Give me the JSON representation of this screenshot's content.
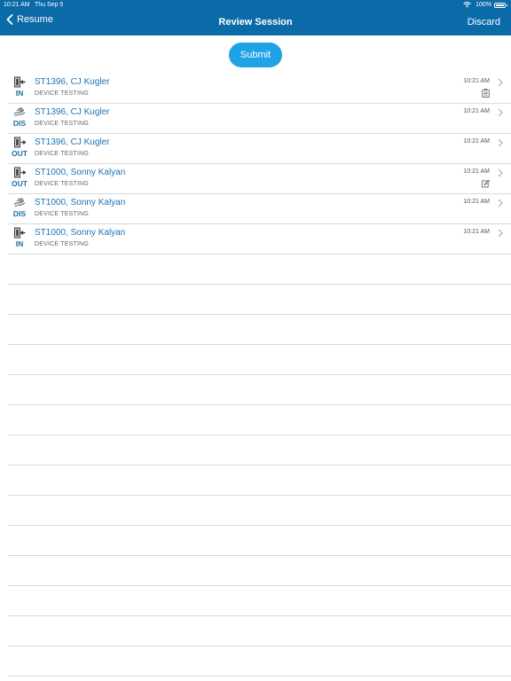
{
  "status_bar": {
    "time": "10:21 AM",
    "date": "Thu Sep 5",
    "battery": "100%"
  },
  "nav": {
    "back_label": "Resume",
    "title": "Review Session",
    "discard_label": "Discard"
  },
  "submit_label": "Submit",
  "colors": {
    "nav_background": "#0b6aa8",
    "submit_background": "#1ea3e6",
    "link_text": "#1a73b5"
  },
  "rows": [
    {
      "type": "IN",
      "icon": "door-in-icon",
      "title": "ST1396, CJ Kugler",
      "subtitle": "DEVICE TESTING",
      "time": "10:21 AM",
      "badge": "clipboard-icon"
    },
    {
      "type": "DIS",
      "icon": "dispense-icon",
      "title": "ST1396, CJ Kugler",
      "subtitle": "DEVICE TESTING",
      "time": "10:21 AM",
      "badge": ""
    },
    {
      "type": "OUT",
      "icon": "door-out-icon",
      "title": "ST1396, CJ Kugler",
      "subtitle": "DEVICE TESTING",
      "time": "10:21 AM",
      "badge": ""
    },
    {
      "type": "OUT",
      "icon": "door-out-icon",
      "title": "ST1000, Sonny Kalyan",
      "subtitle": "DEVICE TESTING",
      "time": "10:21 AM",
      "badge": "edit-note-icon"
    },
    {
      "type": "DIS",
      "icon": "dispense-icon",
      "title": "ST1000, Sonny Kalyan",
      "subtitle": "DEVICE TESTING",
      "time": "10:21 AM",
      "badge": ""
    },
    {
      "type": "IN",
      "icon": "door-in-icon",
      "title": "ST1000, Sonny Kalyan",
      "subtitle": "DEVICE TESTING",
      "time": "10:21 AM",
      "badge": ""
    }
  ]
}
